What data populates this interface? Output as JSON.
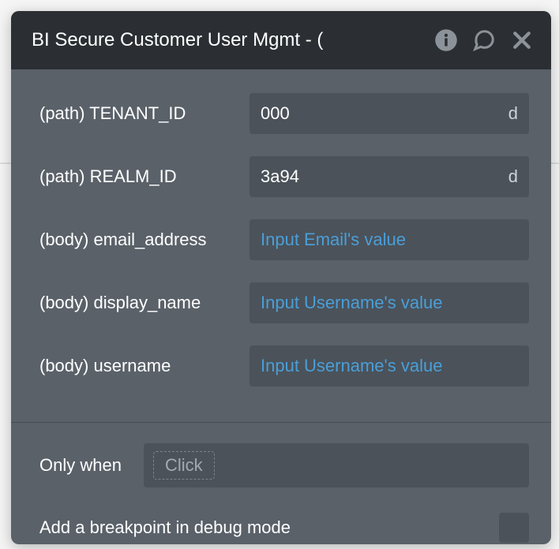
{
  "header": {
    "title": "BI Secure Customer User Mgmt - ("
  },
  "params": [
    {
      "label": "(path) TENANT_ID",
      "value": "000",
      "suffix": "d",
      "placeholder": ""
    },
    {
      "label": "(path) REALM_ID",
      "value": "3a94",
      "suffix": "d",
      "placeholder": ""
    },
    {
      "label": "(body) email_address",
      "value": "",
      "suffix": "",
      "placeholder": "Input Email's value"
    },
    {
      "label": "(body) display_name",
      "value": "",
      "suffix": "",
      "placeholder": "Input Username's value"
    },
    {
      "label": "(body) username",
      "value": "",
      "suffix": "",
      "placeholder": "Input Username's value"
    }
  ],
  "condition": {
    "only_when_label": "Only when",
    "chip": "Click"
  },
  "breakpoint": {
    "label": "Add a breakpoint in debug mode",
    "checked": false
  }
}
